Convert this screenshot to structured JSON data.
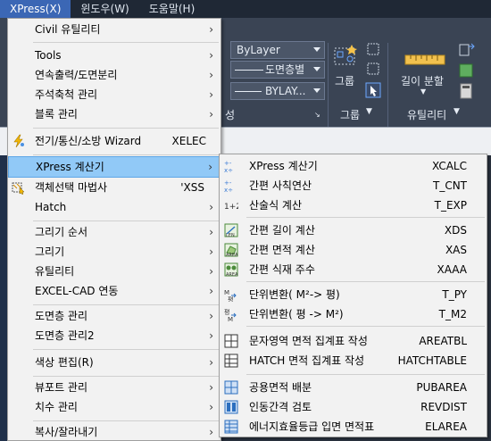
{
  "menubar": {
    "items": [
      {
        "label": "XPress(X)",
        "active": true
      },
      {
        "label": "윈도우(W)",
        "active": false
      },
      {
        "label": "도움말(H)",
        "active": false
      }
    ]
  },
  "ribbon": {
    "layer_combo": "ByLayer",
    "layer_combo2": "도면층별",
    "layer_combo3": "BYLAY...",
    "panel_partial_label": "성",
    "group_button": "그룹",
    "group_panel": "그룹",
    "length_split": "길이 분할",
    "utility_panel": "유틸리티"
  },
  "main_menu": {
    "items": [
      {
        "label": "Civil 유틸리티",
        "shortcut": "",
        "submenu": true,
        "icon": ""
      },
      {
        "label": "Tools",
        "shortcut": "",
        "submenu": true,
        "icon": ""
      },
      {
        "label": "연속출력/도면분리",
        "shortcut": "",
        "submenu": true,
        "icon": ""
      },
      {
        "label": "주석축척 관리",
        "shortcut": "",
        "submenu": true,
        "icon": ""
      },
      {
        "label": "블록 관리",
        "shortcut": "",
        "submenu": true,
        "icon": ""
      },
      {
        "label": "전기/통신/소방 Wizard",
        "shortcut": "XELEC",
        "submenu": false,
        "icon": "lightning-icon"
      },
      {
        "label": "XPress 계산기",
        "shortcut": "",
        "submenu": true,
        "icon": "",
        "highlighted": true
      },
      {
        "label": "객체선택 마법사",
        "shortcut": "'XSS",
        "submenu": false,
        "icon": "select-wizard-icon"
      },
      {
        "label": "Hatch",
        "shortcut": "",
        "submenu": true,
        "icon": ""
      },
      {
        "label": "그리기 순서",
        "shortcut": "",
        "submenu": true,
        "icon": ""
      },
      {
        "label": "그리기",
        "shortcut": "",
        "submenu": true,
        "icon": ""
      },
      {
        "label": "유틸리티",
        "shortcut": "",
        "submenu": true,
        "icon": ""
      },
      {
        "label": "EXCEL-CAD 연동",
        "shortcut": "",
        "submenu": true,
        "icon": ""
      },
      {
        "label": "도면층 관리",
        "shortcut": "",
        "submenu": true,
        "icon": ""
      },
      {
        "label": "도면층 관리2",
        "shortcut": "",
        "submenu": true,
        "icon": ""
      },
      {
        "label": "색상 편집(R)",
        "shortcut": "",
        "submenu": true,
        "icon": ""
      },
      {
        "label": "뷰포트 관리",
        "shortcut": "",
        "submenu": true,
        "icon": ""
      },
      {
        "label": "치수 관리",
        "shortcut": "",
        "submenu": true,
        "icon": ""
      },
      {
        "label": "복사/잘라내기",
        "shortcut": "",
        "submenu": true,
        "icon": ""
      }
    ]
  },
  "submenu": {
    "items": [
      {
        "label": "XPress 계산기",
        "shortcut": "XCALC",
        "icon": "calculator-ops-icon"
      },
      {
        "label": "간편 사칙연산",
        "shortcut": "T_CNT",
        "icon": "arithmetic-icon"
      },
      {
        "label": "산술식 계산",
        "shortcut": "T_EXP",
        "icon": "expression-icon"
      },
      {
        "label": "간편 길이 계산",
        "shortcut": "XDS",
        "icon": "length-calc-icon"
      },
      {
        "label": "간편 면적 계산",
        "shortcut": "XAS",
        "icon": "area-calc-icon"
      },
      {
        "label": "간편 식재 주수",
        "shortcut": "XAAA",
        "icon": "planting-count-icon"
      },
      {
        "label": "단위변환( M²-> 평)",
        "shortcut": "T_PY",
        "icon": "unit-convert-icon"
      },
      {
        "label": "단위변환( 평 -> M²)",
        "shortcut": "T_M2",
        "icon": "unit-convert-reverse-icon"
      },
      {
        "label": "문자영역 면적 집계표 작성",
        "shortcut": "AREATBL",
        "icon": "text-area-table-icon"
      },
      {
        "label": "HATCH 면적 집계표 작성",
        "shortcut": "HATCHTABLE",
        "icon": "hatch-table-icon"
      },
      {
        "label": "공용면적 배분",
        "shortcut": "PUBAREA",
        "icon": "public-area-icon"
      },
      {
        "label": "인동간격 검토",
        "shortcut": "REVDIST",
        "icon": "distance-review-icon"
      },
      {
        "label": "에너지효율등급 입면 면적표",
        "shortcut": "ELAREA",
        "icon": "energy-table-icon"
      }
    ]
  },
  "colors": {
    "menu_bg": "#f2f2f2",
    "highlight": "#91c9f7",
    "menubar_active": "#3b67b5"
  }
}
